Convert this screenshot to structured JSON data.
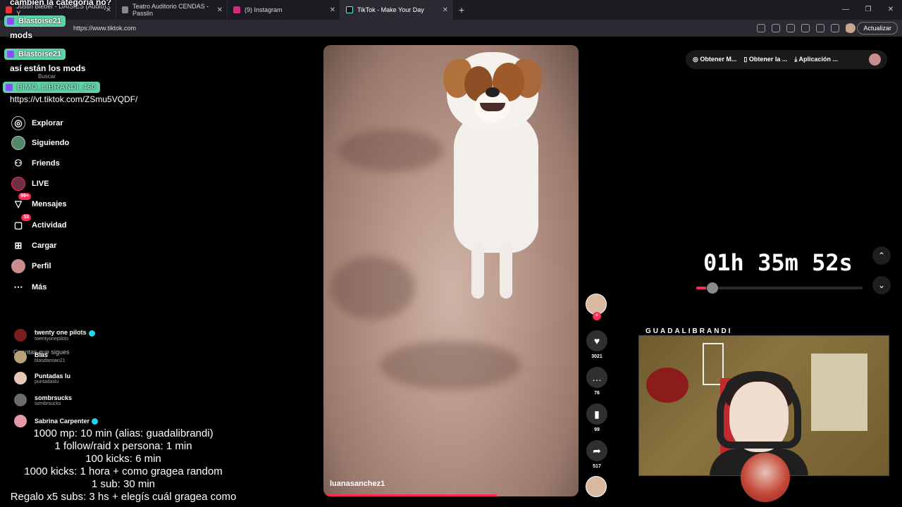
{
  "browser": {
    "tabs": [
      {
        "title": "Justin Bieber - DAISIES (Audio) - Y",
        "active": false
      },
      {
        "title": "Teatro Auditorio CENDAS - Passlin",
        "active": false
      },
      {
        "title": "(9) Instagram",
        "active": false
      },
      {
        "title": "TikTok - Make Your Day",
        "active": true
      }
    ],
    "new_tab": "+",
    "url": "https://www.tiktok.com",
    "update_label": "Actualizar",
    "window_controls": [
      "—",
      "❐",
      "✕"
    ]
  },
  "chat": {
    "messages": [
      {
        "text": "cambien la categoria no?"
      },
      {
        "user": "Blastoise21",
        "color": "#5fd3a7"
      },
      {
        "text": "mods"
      },
      {
        "user": "Blastoise21",
        "color": "#5fd3a7"
      },
      {
        "text": "así están los mods"
      },
      {
        "text": "Buscar"
      },
      {
        "user": "BIMO_LIBRANDI_460",
        "color": "#5fd3a7"
      },
      {
        "text": "https://vt.tiktok.com/ZSmu5VQDF/"
      }
    ]
  },
  "sidebar": {
    "nav": [
      {
        "label": "Explorar",
        "icon": "compass-icon",
        "glyph": "◎",
        "badge": ""
      },
      {
        "label": "Siguiendo",
        "icon": "following-icon",
        "glyph": "",
        "badge": ""
      },
      {
        "label": "Friends",
        "icon": "friends-icon",
        "glyph": "⚇",
        "badge": ""
      },
      {
        "label": "LIVE",
        "icon": "live-icon",
        "glyph": "",
        "badge": ""
      },
      {
        "label": "Mensajes",
        "icon": "messages-icon",
        "glyph": "▽",
        "badge": "99+"
      },
      {
        "label": "Actividad",
        "icon": "activity-icon",
        "glyph": "▢",
        "badge": "33"
      },
      {
        "label": "Cargar",
        "icon": "upload-icon",
        "glyph": "⊞",
        "badge": ""
      },
      {
        "label": "Perfil",
        "icon": "profile-icon",
        "glyph": "",
        "badge": ""
      },
      {
        "label": "Más",
        "icon": "more-icon",
        "glyph": "⋯",
        "badge": ""
      }
    ],
    "following_title": "Cuentas que sigues",
    "following": [
      {
        "name": "twenty one pilots",
        "handle": "twentyonepilots",
        "verified": true,
        "color": "#7a1f1f"
      },
      {
        "name": "Blas",
        "handle": "blasdamian21",
        "verified": false,
        "color": "#b8a27a"
      },
      {
        "name": "Puntadas lu",
        "handle": "puntadaslu",
        "verified": false,
        "color": "#e9c7b8"
      },
      {
        "name": "sombrsucks",
        "handle": "sombrsucks",
        "verified": false,
        "color": "#6b6b6b"
      },
      {
        "name": "Sabrina Carpenter",
        "handle": "",
        "verified": true,
        "color": "#e39aa8"
      }
    ]
  },
  "video": {
    "username": "luanasanchez1",
    "progress": 0.68
  },
  "actions": [
    {
      "icon": "heart-icon",
      "glyph": "♥",
      "count": "3021"
    },
    {
      "icon": "comment-icon",
      "glyph": "…",
      "count": "76"
    },
    {
      "icon": "bookmark-icon",
      "glyph": "▮",
      "count": "99"
    },
    {
      "icon": "share-icon",
      "glyph": "➦",
      "count": "517"
    }
  ],
  "top_right": {
    "items": [
      {
        "label": "Obtener M...",
        "icon": "coin-icon",
        "glyph": "◎"
      },
      {
        "label": "Obtener la ...",
        "icon": "phone-icon",
        "glyph": "▯"
      },
      {
        "label": "Aplicación ...",
        "icon": "download-icon",
        "glyph": "⤓"
      }
    ]
  },
  "timer": {
    "text": "01h 35m 52s",
    "progress": 0.06
  },
  "nav_arrows": {
    "up": "⌃",
    "down": "⌄"
  },
  "webcam": {
    "label": "GUADALIBRANDI"
  },
  "goals": [
    "1000 mp: 10 min (alias: guadalibrandi)",
    "1 follow/raid x persona: 1 min",
    "100 kicks: 6 min",
    "1000 kicks: 1 hora + como gragea random",
    "1 sub: 30 min",
    "Regalo x5 subs: 3 hs + elegís cuál gragea como"
  ]
}
